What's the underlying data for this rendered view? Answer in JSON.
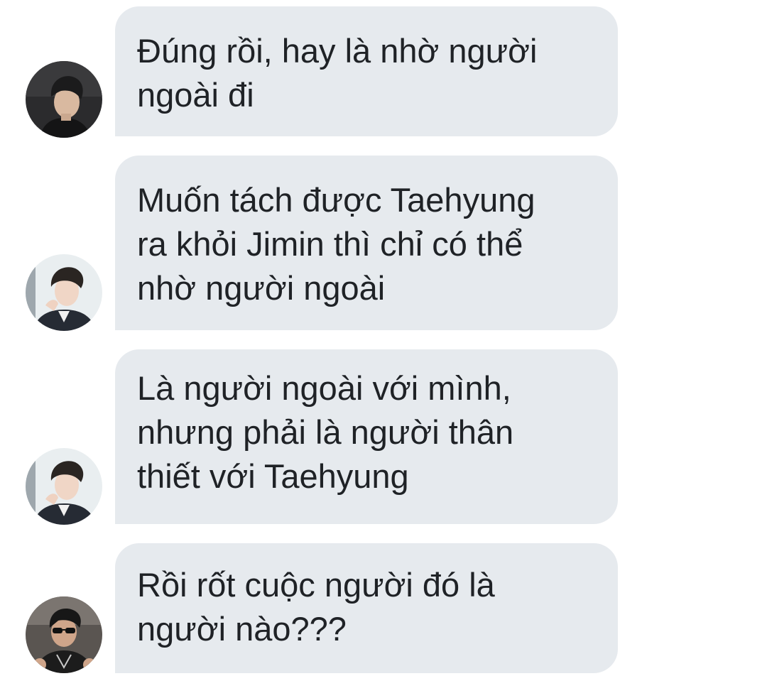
{
  "messages": [
    {
      "text": "Đúng rồi, hay là nhờ người\nngoài đi",
      "avatar_icon": "dark-portrait-avatar"
    },
    {
      "text": "Muốn tách được Taehyung\nra khỏi Jimin thì chỉ có thể\nnhờ người ngoài",
      "avatar_icon": "light-portrait-avatar"
    },
    {
      "text": "Là người ngoài với mình,\nnhưng phải là người thân\nthiết với Taehyung",
      "avatar_icon": "light-portrait-avatar"
    },
    {
      "text": "Rồi rốt cuộc người đó là\nngười nào???",
      "avatar_icon": "sunglasses-portrait-avatar"
    }
  ],
  "colors": {
    "bubble_background": "#e6eaee",
    "text": "#1f2226",
    "page_background": "#ffffff"
  }
}
